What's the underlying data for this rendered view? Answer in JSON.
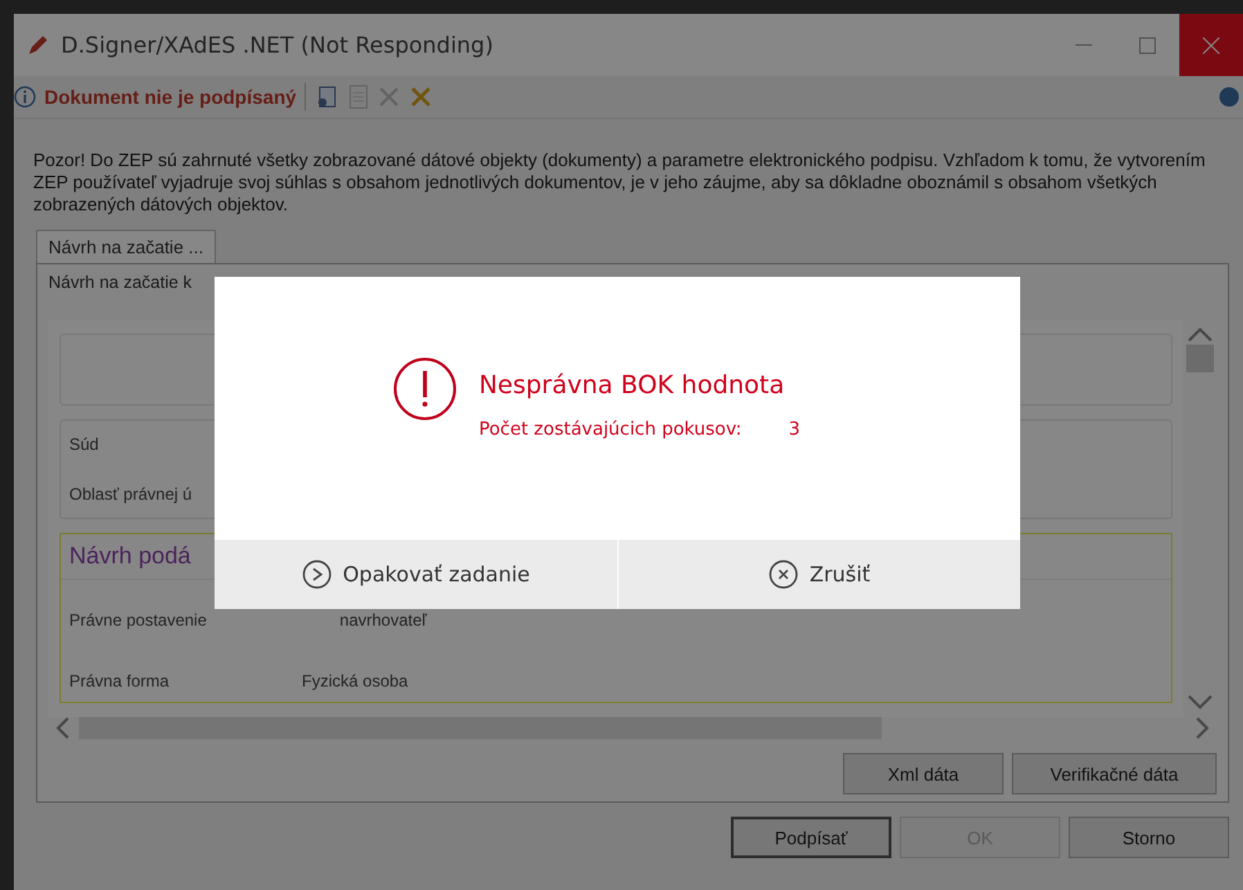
{
  "window": {
    "title": "D.Signer/XAdES .NET (Not Responding)"
  },
  "toolbar": {
    "status": "Dokument nie je podpísaný"
  },
  "notice": "Pozor! Do ZEP sú zahrnuté všetky zobrazované dátové objekty (dokumenty) a parametre elektronického podpisu. Vzhľadom k tomu, že vytvorením ZEP používateľ vyjadruje svoj súhlas s obsahom jednotlivých dokumentov, je v jeho záujme, aby sa dôkladne oboznámil s obsahom všetkých zobrazených dátových objektov.",
  "tabs": [
    {
      "label": "Návrh na začatie ...",
      "selected": true
    }
  ],
  "document": {
    "heading": "Návrh na začatie k",
    "fields": [
      {
        "label": "Súd"
      },
      {
        "label": "Oblasť právnej ú"
      }
    ],
    "section": {
      "title": "Návrh podá",
      "rows": [
        {
          "label": "Právne postavenie",
          "value": "navrhovateľ"
        },
        {
          "label": "Právna forma",
          "value": "Fyzická osoba"
        }
      ]
    }
  },
  "panel_buttons": [
    {
      "label": "Xml dáta"
    },
    {
      "label": "Verifikačné dáta"
    }
  ],
  "buttons": [
    {
      "label": "Podpísať",
      "disabled": false,
      "default": true
    },
    {
      "label": "OK",
      "disabled": true,
      "default": false
    },
    {
      "label": "Storno",
      "disabled": false,
      "default": false
    }
  ],
  "dialog": {
    "title": "Nesprávna BOK hodnota",
    "attempts_label": "Počet zostávajúcich pokusov:",
    "attempts_value": "3",
    "buttons": [
      {
        "label": "Opakovať zadanie",
        "kind": "retry"
      },
      {
        "label": "Zrušiť",
        "kind": "cancel"
      }
    ]
  }
}
